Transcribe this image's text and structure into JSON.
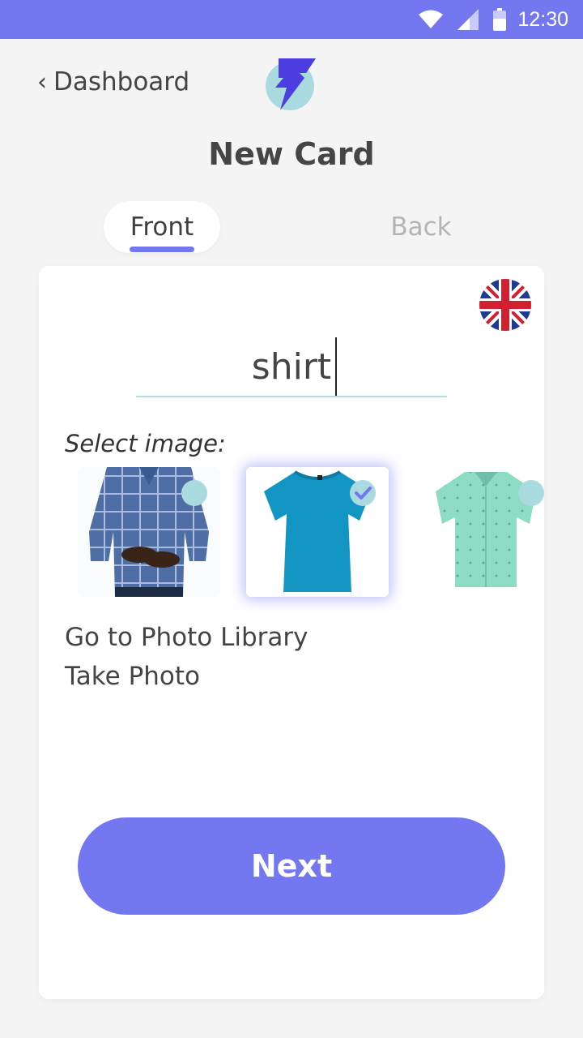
{
  "status_bar": {
    "time": "12:30",
    "icons": [
      "wifi-icon",
      "cell-signal-icon",
      "battery-icon"
    ],
    "background": "#7478f0"
  },
  "header": {
    "back_label": "Dashboard",
    "logo": "lightning-bolt-logo",
    "title": "New Card"
  },
  "tabs": [
    {
      "label": "Front",
      "active": true
    },
    {
      "label": "Back",
      "active": false
    }
  ],
  "card": {
    "language_flag": "uk-flag-icon",
    "word_value": "shirt",
    "select_label": "Select image:",
    "images": [
      {
        "name": "plaid-shirt-image",
        "selected": false
      },
      {
        "name": "blue-tshirt-image",
        "selected": true
      },
      {
        "name": "mint-shirt-image",
        "selected": false
      }
    ],
    "library_link": "Go to Photo Library",
    "photo_link": "Take Photo",
    "next_label": "Next"
  },
  "colors": {
    "accent": "#7478f0",
    "teal_light": "#a8dadf",
    "muted_text": "#b4b4b4"
  }
}
